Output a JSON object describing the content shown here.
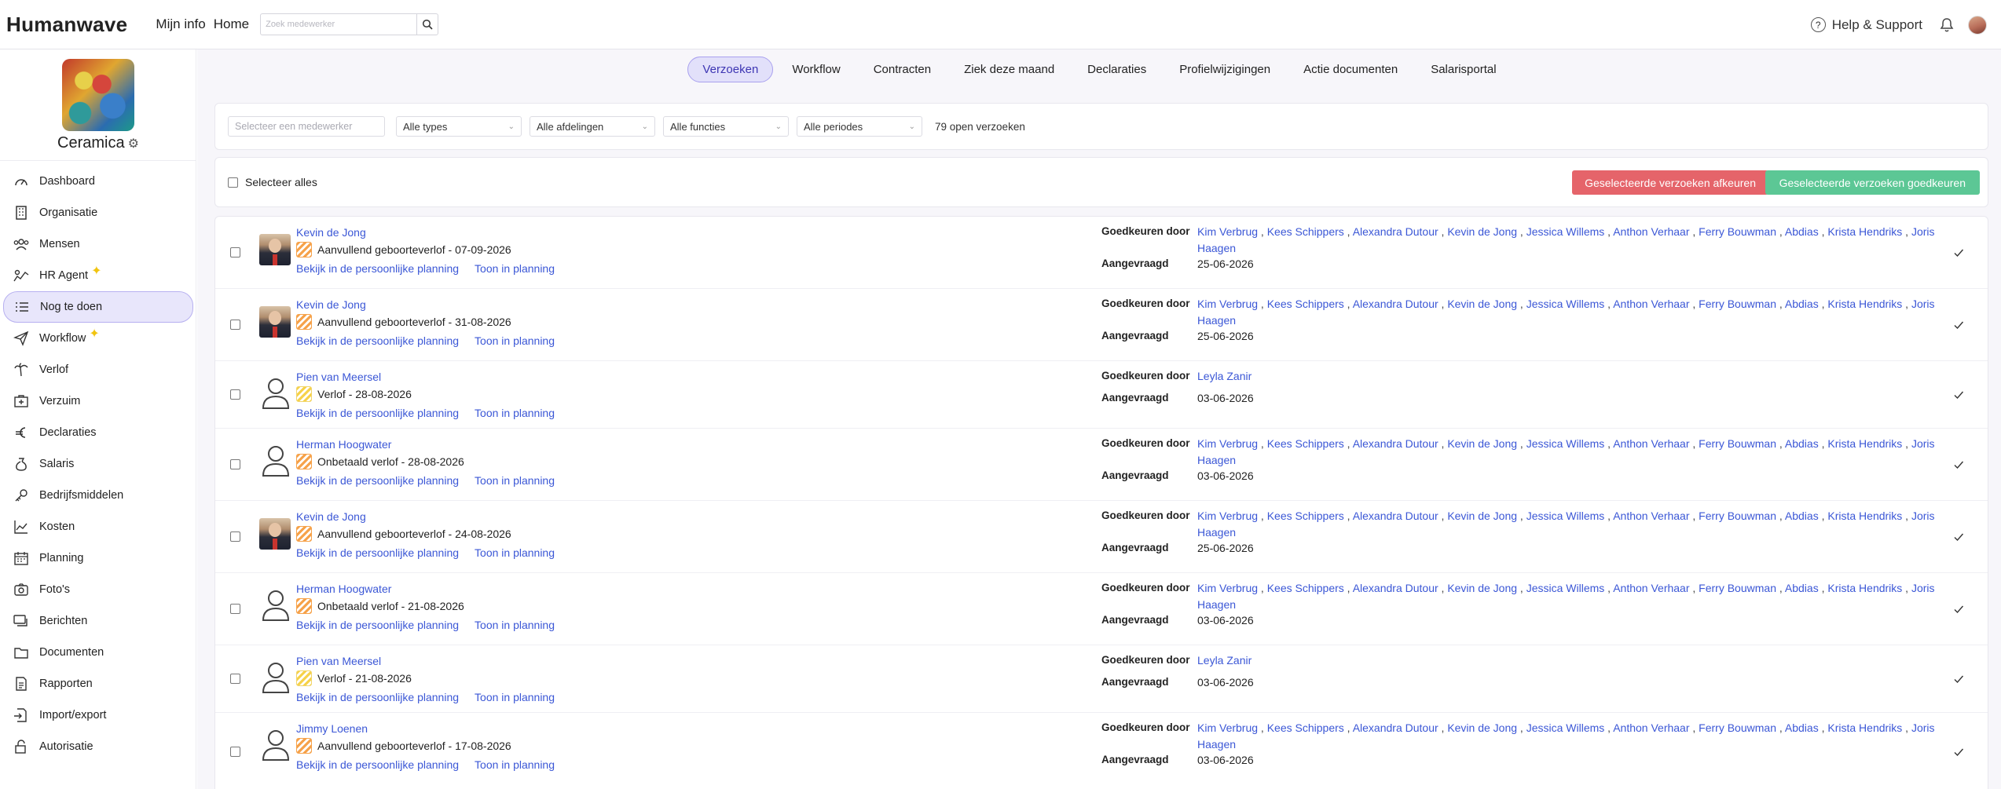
{
  "topbar": {
    "logo": "Humanwave",
    "nav": [
      "Mijn info",
      "Home"
    ],
    "search_placeholder": "Zoek medewerker",
    "help_label": "Help & Support"
  },
  "sidebar": {
    "company": "Ceramica",
    "items": [
      {
        "label": "Dashboard",
        "icon": "dashboard-icon"
      },
      {
        "label": "Organisatie",
        "icon": "building-icon"
      },
      {
        "label": "Mensen",
        "icon": "people-icon"
      },
      {
        "label": "HR Agent",
        "icon": "hr-agent-icon",
        "sparkle": true
      },
      {
        "label": "Nog te doen",
        "icon": "todo-list-icon",
        "active": true
      },
      {
        "label": "Workflow",
        "icon": "paper-plane-icon",
        "sparkle": true
      },
      {
        "label": "Verlof",
        "icon": "palm-tree-icon"
      },
      {
        "label": "Verzuim",
        "icon": "medical-kit-icon"
      },
      {
        "label": "Declaraties",
        "icon": "euro-icon"
      },
      {
        "label": "Salaris",
        "icon": "money-bag-icon"
      },
      {
        "label": "Bedrijfsmiddelen",
        "icon": "key-icon"
      },
      {
        "label": "Kosten",
        "icon": "chart-icon"
      },
      {
        "label": "Planning",
        "icon": "calendar-icon"
      },
      {
        "label": "Foto's",
        "icon": "camera-icon"
      },
      {
        "label": "Berichten",
        "icon": "message-icon"
      },
      {
        "label": "Documenten",
        "icon": "folder-icon"
      },
      {
        "label": "Rapporten",
        "icon": "report-icon"
      },
      {
        "label": "Import/export",
        "icon": "import-export-icon"
      },
      {
        "label": "Autorisatie",
        "icon": "lock-icon"
      }
    ]
  },
  "tabs": [
    {
      "label": "Verzoeken",
      "active": true
    },
    {
      "label": "Workflow"
    },
    {
      "label": "Contracten"
    },
    {
      "label": "Ziek deze maand"
    },
    {
      "label": "Declaraties"
    },
    {
      "label": "Profielwijzigingen"
    },
    {
      "label": "Actie documenten"
    },
    {
      "label": "Salarisportal"
    }
  ],
  "filters": {
    "employee_placeholder": "Selecteer een medewerker",
    "types": "Alle types",
    "departments": "Alle afdelingen",
    "functions": "Alle functies",
    "periods": "Alle periodes",
    "open_count": "79 open verzoeken"
  },
  "bulk": {
    "select_all": "Selecteer alles",
    "reject_label": "Geselecteerde verzoeken afkeuren",
    "approve_label": "Geselecteerde verzoeken goedkeuren"
  },
  "labels": {
    "approve_by": "Goedkeuren door",
    "requested": "Aangevraagd",
    "view_planning": "Bekijk in de persoonlijke planning",
    "show_planning": "Toon in planning"
  },
  "colors": {
    "accent": "#3b57d6",
    "reject": "#e5646a",
    "approve": "#5cc795",
    "active_tab": "#e2e0fa"
  },
  "requests": [
    {
      "name": "Kevin de Jong",
      "photo": true,
      "type_color": "orange",
      "type": "Aanvullend geboorteverlof - 07-09-2026",
      "approvers": [
        "Kim Verbrug",
        "Kees Schippers",
        "Alexandra Dutour",
        "Kevin de Jong",
        "Jessica Willems",
        "Anthon Verhaar",
        "Ferry Bouwman",
        "Abdias",
        "Krista Hendriks",
        "Joris Haagen"
      ],
      "requested": "25-06-2026"
    },
    {
      "name": "Kevin de Jong",
      "photo": true,
      "type_color": "orange",
      "type": "Aanvullend geboorteverlof - 31-08-2026",
      "approvers": [
        "Kim Verbrug",
        "Kees Schippers",
        "Alexandra Dutour",
        "Kevin de Jong",
        "Jessica Willems",
        "Anthon Verhaar",
        "Ferry Bouwman",
        "Abdias",
        "Krista Hendriks",
        "Joris Haagen"
      ],
      "requested": "25-06-2026"
    },
    {
      "name": "Pien van Meersel",
      "photo": false,
      "type_color": "yellow",
      "type": "Verlof - 28-08-2026",
      "approvers": [
        "Leyla Zanir"
      ],
      "requested": "03-06-2026"
    },
    {
      "name": "Herman Hoogwater",
      "photo": false,
      "type_color": "orange",
      "type": "Onbetaald verlof - 28-08-2026",
      "approvers": [
        "Kim Verbrug",
        "Kees Schippers",
        "Alexandra Dutour",
        "Kevin de Jong",
        "Jessica Willems",
        "Anthon Verhaar",
        "Ferry Bouwman",
        "Abdias",
        "Krista Hendriks",
        "Joris Haagen"
      ],
      "requested": "03-06-2026"
    },
    {
      "name": "Kevin de Jong",
      "photo": true,
      "type_color": "orange",
      "type": "Aanvullend geboorteverlof - 24-08-2026",
      "approvers": [
        "Kim Verbrug",
        "Kees Schippers",
        "Alexandra Dutour",
        "Kevin de Jong",
        "Jessica Willems",
        "Anthon Verhaar",
        "Ferry Bouwman",
        "Abdias",
        "Krista Hendriks",
        "Joris Haagen"
      ],
      "requested": "25-06-2026"
    },
    {
      "name": "Herman Hoogwater",
      "photo": false,
      "type_color": "orange",
      "type": "Onbetaald verlof - 21-08-2026",
      "approvers": [
        "Kim Verbrug",
        "Kees Schippers",
        "Alexandra Dutour",
        "Kevin de Jong",
        "Jessica Willems",
        "Anthon Verhaar",
        "Ferry Bouwman",
        "Abdias",
        "Krista Hendriks",
        "Joris Haagen"
      ],
      "requested": "03-06-2026"
    },
    {
      "name": "Pien van Meersel",
      "photo": false,
      "type_color": "yellow",
      "type": "Verlof - 21-08-2026",
      "approvers": [
        "Leyla Zanir"
      ],
      "requested": "03-06-2026"
    },
    {
      "name": "Jimmy Loenen",
      "photo": false,
      "type_color": "orange",
      "type": "Aanvullend geboorteverlof - 17-08-2026",
      "approvers": [
        "Kim Verbrug",
        "Kees Schippers",
        "Alexandra Dutour",
        "Kevin de Jong",
        "Jessica Willems",
        "Anthon Verhaar",
        "Ferry Bouwman",
        "Abdias",
        "Krista Hendriks",
        "Joris Haagen"
      ],
      "requested": "03-06-2026"
    }
  ]
}
